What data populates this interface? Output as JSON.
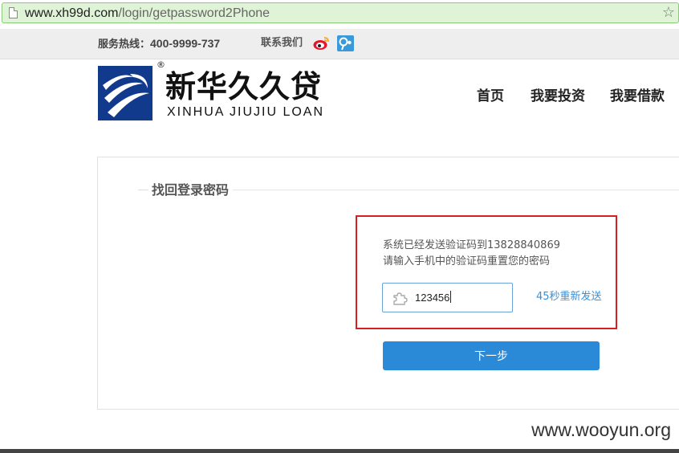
{
  "browser": {
    "url_domain": "www.xh99d.com",
    "url_path": "/login/getpassword2Phone"
  },
  "topbar": {
    "hotline_label": "服务热线：",
    "hotline_number": "400-9999-737",
    "contact_label": "联系我们"
  },
  "header": {
    "logo_cn": "新华久久贷",
    "logo_en": "XINHUA JIUJIU LOAN",
    "registered_mark": "®",
    "nav": [
      {
        "label": "首页"
      },
      {
        "label": "我要投资"
      },
      {
        "label": "我要借款"
      }
    ]
  },
  "main": {
    "section_title": "找回登录密码",
    "message_line1": "系统已经发送验证码到13828840869",
    "message_line2": "请输入手机中的验证码重置您的密码",
    "code_input_value": "123456",
    "resend_label": "45秒重新发送",
    "next_button_label": "下一步"
  },
  "watermark": "www.wooyun.org",
  "colors": {
    "accent_blue": "#2a8ad8",
    "highlight_red": "#d62020",
    "logo_navy": "#123a8c",
    "link_blue": "#3a8fd6"
  }
}
